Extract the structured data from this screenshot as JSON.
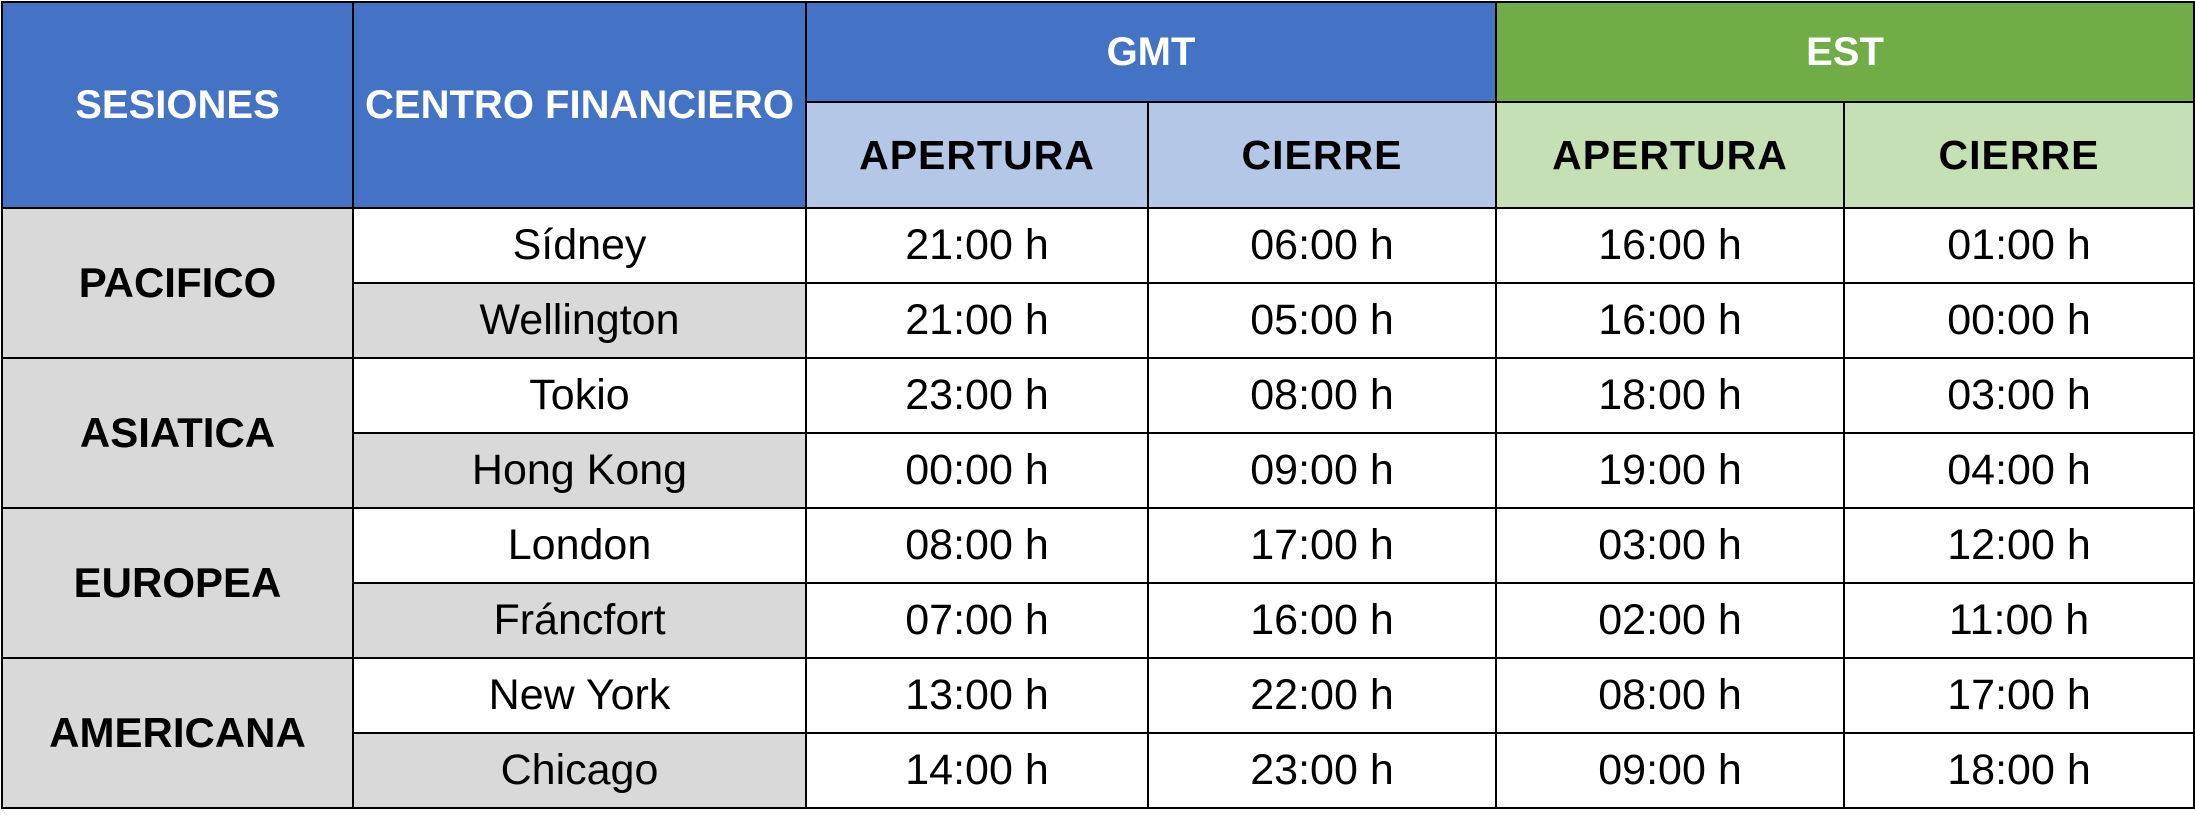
{
  "header": {
    "sesiones": "SESIONES",
    "centro": "CENTRO FINANCIERO",
    "gmt": "GMT",
    "est": "EST",
    "apertura": "APERTURA",
    "cierre": "CIERRE"
  },
  "sessions": [
    {
      "name": "PACIFICO",
      "cities": [
        {
          "city": "Sídney",
          "gmt_open": "21:00 h",
          "gmt_close": "06:00 h",
          "est_open": "16:00 h",
          "est_close": "01:00 h"
        },
        {
          "city": "Wellington",
          "gmt_open": "21:00 h",
          "gmt_close": "05:00 h",
          "est_open": "16:00 h",
          "est_close": "00:00 h"
        }
      ]
    },
    {
      "name": "ASIATICA",
      "cities": [
        {
          "city": "Tokio",
          "gmt_open": "23:00 h",
          "gmt_close": "08:00 h",
          "est_open": "18:00 h",
          "est_close": "03:00 h"
        },
        {
          "city": "Hong Kong",
          "gmt_open": "00:00 h",
          "gmt_close": "09:00 h",
          "est_open": "19:00 h",
          "est_close": "04:00 h"
        }
      ]
    },
    {
      "name": "EUROPEA",
      "cities": [
        {
          "city": "London",
          "gmt_open": "08:00 h",
          "gmt_close": "17:00 h",
          "est_open": "03:00 h",
          "est_close": "12:00 h"
        },
        {
          "city": "Fráncfort",
          "gmt_open": "07:00 h",
          "gmt_close": "16:00 h",
          "est_open": "02:00 h",
          "est_close": "11:00 h"
        }
      ]
    },
    {
      "name": "AMERICANA",
      "cities": [
        {
          "city": "New York",
          "gmt_open": "13:00 h",
          "gmt_close": "22:00 h",
          "est_open": "08:00 h",
          "est_close": "17:00 h"
        },
        {
          "city": "Chicago",
          "gmt_open": "14:00 h",
          "gmt_close": "23:00 h",
          "est_open": "09:00 h",
          "est_close": "18:00 h"
        }
      ]
    }
  ],
  "colors": {
    "header_blue": "#4472c4",
    "header_green": "#70ad47",
    "sub_blue": "#b4c7e7",
    "sub_green": "#c5e0b4",
    "row_gray": "#d9d9d9"
  }
}
